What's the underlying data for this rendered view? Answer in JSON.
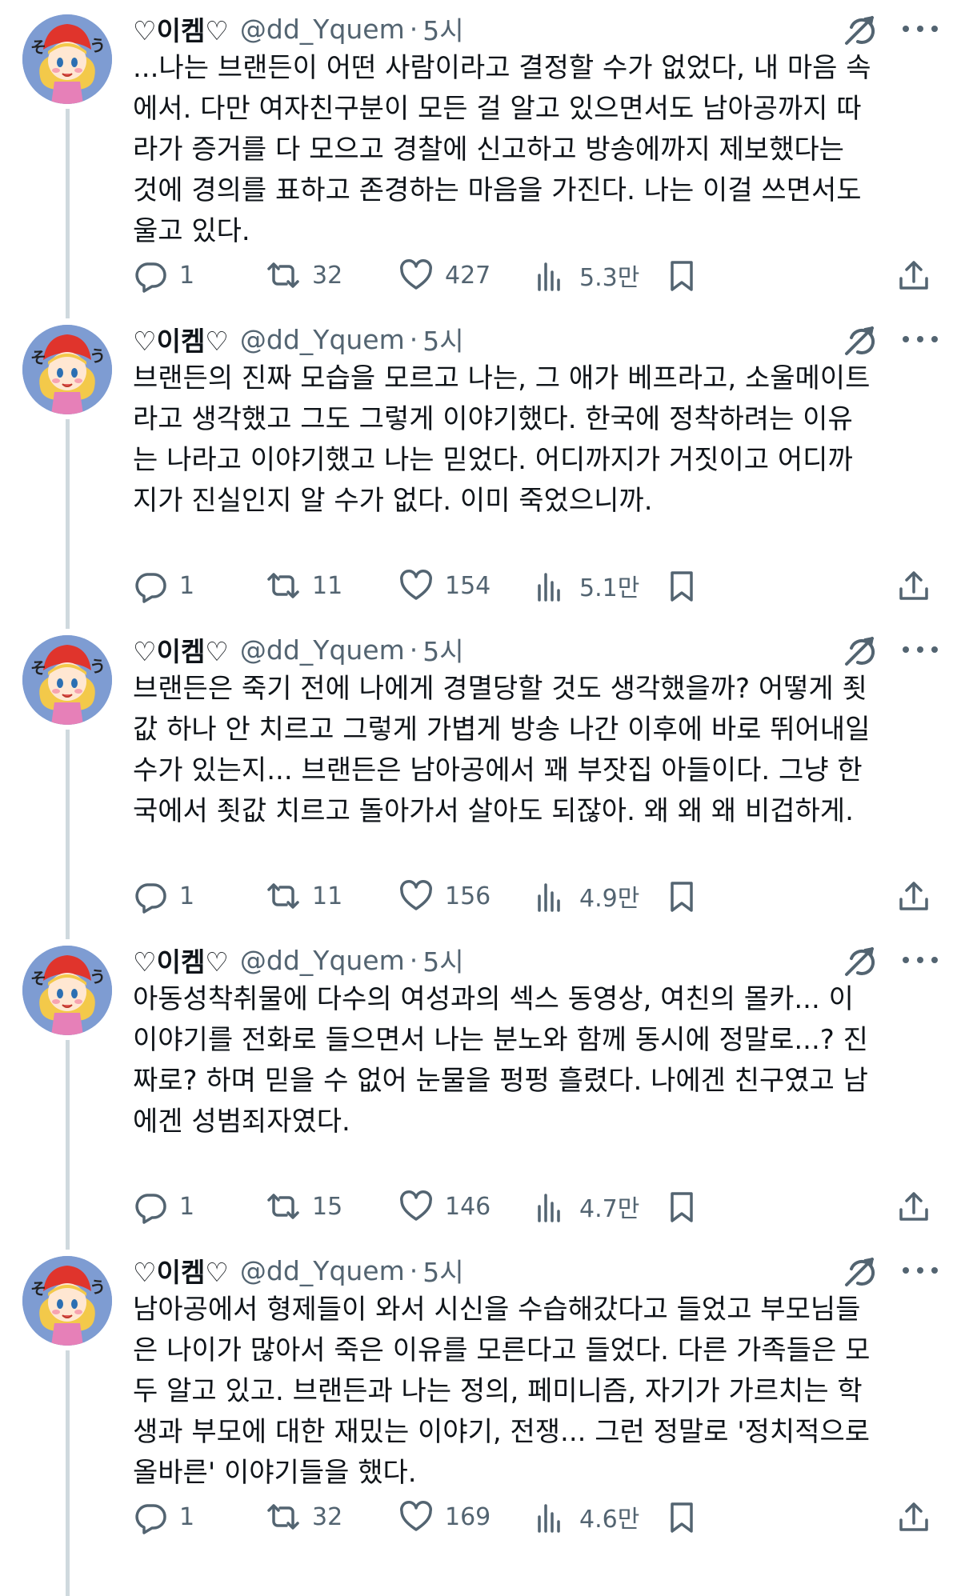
{
  "colors": {
    "text": "#0f1419",
    "secondary": "#536471",
    "thread_line": "#cfd9de",
    "avatar_bg": "#7e9cd2",
    "icon": "#536471"
  },
  "icons": {
    "reply": "reply-icon",
    "retweet": "retweet-icon",
    "like": "heart-icon",
    "views": "views-icon",
    "bookmark": "bookmark-icon",
    "share": "share-icon",
    "grok": "grok-icon",
    "more": "more-icon"
  },
  "tweets": [
    {
      "name": "♡이켐♡",
      "handle": "@dd_Yquem",
      "separator": "·",
      "time": "5시",
      "text": "...나는 브랜든이 어떤 사람이라고 결정할 수가 없었다, 내 마음 속\n에서. 다만 여자친구분이 모든 걸 알고 있으면서도 남아공까지 따\n라가 증거를 다 모으고 경찰에 신고하고 방송에까지 제보했다는\n것에 경의를 표하고 존경하는 마음을 가진다. 나는 이걸 쓰면서도\n울고 있다.",
      "replies": "1",
      "retweets": "32",
      "likes": "427",
      "views": "5.3만"
    },
    {
      "name": "♡이켐♡",
      "handle": "@dd_Yquem",
      "separator": "·",
      "time": "5시",
      "text": "브랜든의 진짜 모습을 모르고 나는, 그 애가 베프라고, 소울메이트\n라고 생각했고 그도 그렇게 이야기했다. 한국에 정착하려는 이유\n는 나라고 이야기했고 나는 믿었다. 어디까지가 거짓이고 어디까\n지가 진실인지 알 수가 없다. 이미 죽었으니까.",
      "replies": "1",
      "retweets": "11",
      "likes": "154",
      "views": "5.1만"
    },
    {
      "name": "♡이켐♡",
      "handle": "@dd_Yquem",
      "separator": "·",
      "time": "5시",
      "text": "브랜든은 죽기 전에 나에게 경멸당할 것도 생각했을까? 어떻게 죗\n값 하나 안 치르고 그렇게 가볍게 방송 나간 이후에 바로 뛰어내일\n수가 있는지... 브랜든은 남아공에서 꽤 부잣집 아들이다. 그냥 한\n국에서 죗값 치르고 돌아가서 살아도 되잖아. 왜 왜 왜 비겁하게.",
      "replies": "1",
      "retweets": "11",
      "likes": "156",
      "views": "4.9만"
    },
    {
      "name": "♡이켐♡",
      "handle": "@dd_Yquem",
      "separator": "·",
      "time": "5시",
      "text": "아동성착취물에 다수의 여성과의 섹스 동영상, 여친의 몰카... 이\n이야기를 전화로 들으면서 나는 분노와 함께 동시에 정말로...? 진\n짜로? 하며 믿을 수 없어 눈물을 펑펑 흘렸다. 나에겐 친구였고 남\n에겐 성범죄자였다.",
      "replies": "1",
      "retweets": "15",
      "likes": "146",
      "views": "4.7만"
    },
    {
      "name": "♡이켐♡",
      "handle": "@dd_Yquem",
      "separator": "·",
      "time": "5시",
      "text": "남아공에서 형제들이 와서 시신을 수습해갔다고 들었고 부모님들\n은 나이가 많아서 죽은 이유를 모른다고 들었다. 다른 가족들은 모\n두 알고 있고. 브랜든과 나는 정의, 페미니즘, 자기가 가르치는 학\n생과 부모에 대한 재밌는 이야기, 전쟁... 그런 정말로 '정치적으로\n올바른' 이야기들을 했다.",
      "replies": "1",
      "retweets": "32",
      "likes": "169",
      "views": "4.6만"
    }
  ]
}
